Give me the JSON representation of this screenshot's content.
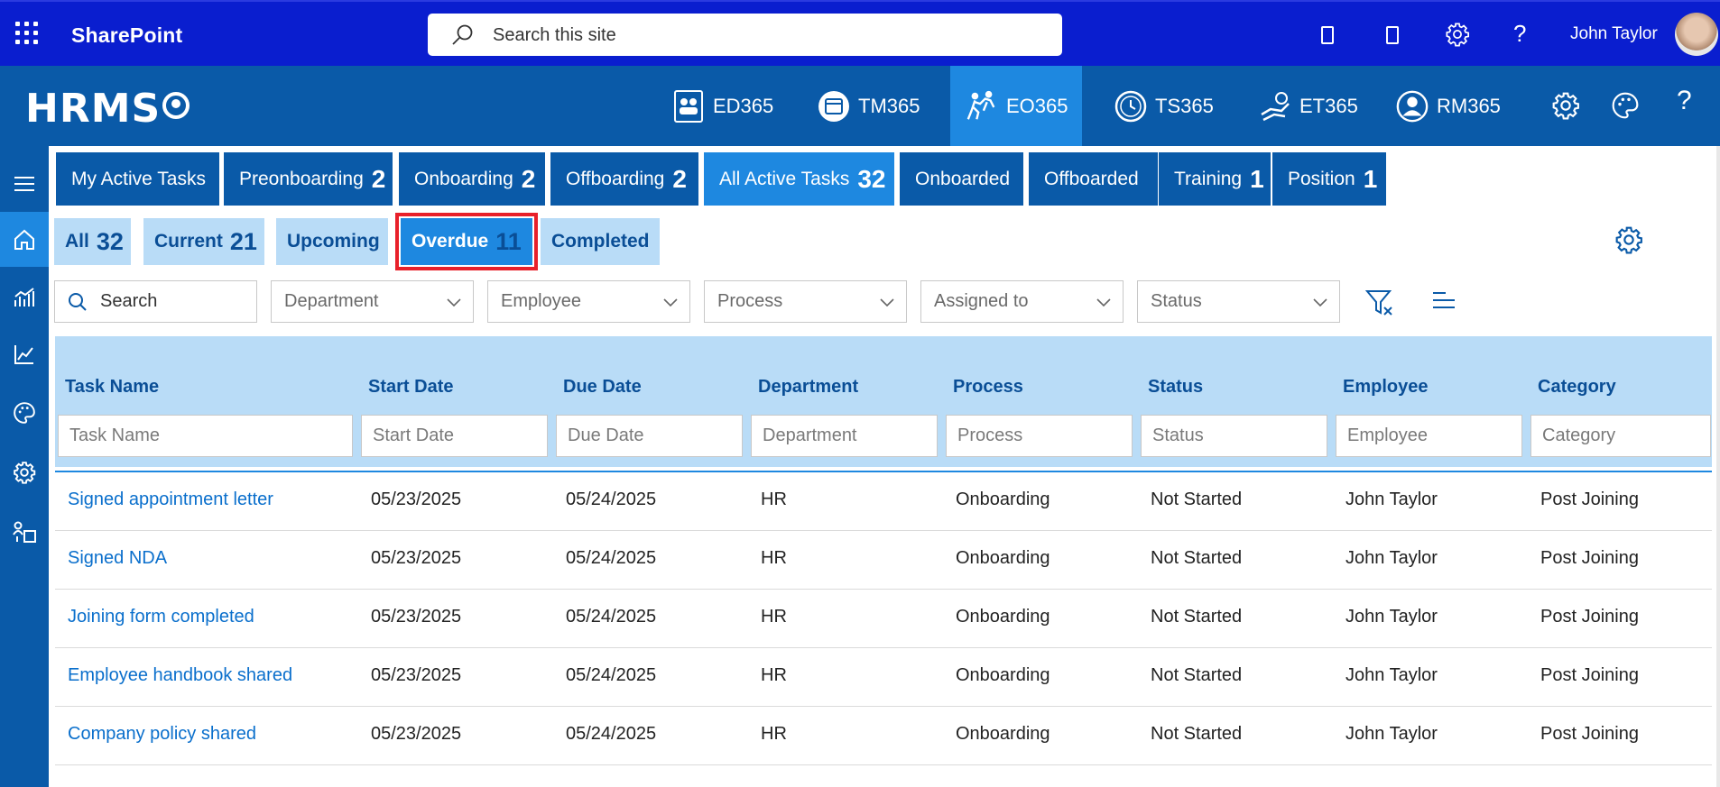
{
  "suite": {
    "app_name": "SharePoint",
    "search_placeholder": "Search this site",
    "user_name": "John Taylor"
  },
  "header": {
    "logo_text": "HRMS",
    "nav": [
      {
        "label": "ED365"
      },
      {
        "label": "TM365"
      },
      {
        "label": "EO365",
        "active": true
      },
      {
        "label": "TS365"
      },
      {
        "label": "ET365"
      },
      {
        "label": "RM365"
      }
    ]
  },
  "main_tabs": [
    {
      "label": "My Active Tasks",
      "count": ""
    },
    {
      "label": "Preonboarding",
      "count": "2"
    },
    {
      "label": "Onboarding",
      "count": "2"
    },
    {
      "label": "Offboarding",
      "count": "2"
    },
    {
      "label": "All Active Tasks",
      "count": "32",
      "active": true
    },
    {
      "label": "Onboarded",
      "count": ""
    },
    {
      "label": "Offboarded",
      "count": ""
    },
    {
      "label": "Training",
      "count": "1"
    },
    {
      "label": "Position",
      "count": "1"
    }
  ],
  "sub_tabs": [
    {
      "label": "All",
      "count": "32"
    },
    {
      "label": "Current",
      "count": "21"
    },
    {
      "label": "Upcoming",
      "count": ""
    },
    {
      "label": "Overdue",
      "count": "11",
      "active": true
    },
    {
      "label": "Completed",
      "count": ""
    }
  ],
  "filters": {
    "search": "Search",
    "department": "Department",
    "employee": "Employee",
    "process": "Process",
    "assigned_to": "Assigned to",
    "status": "Status"
  },
  "table": {
    "columns": [
      "Task Name",
      "Start Date",
      "Due Date",
      "Department",
      "Process",
      "Status",
      "Employee",
      "Category"
    ],
    "column_filters": [
      "Task Name",
      "Start Date",
      "Due Date",
      "Department",
      "Process",
      "Status",
      "Employee",
      "Category"
    ],
    "rows": [
      [
        "Signed appointment letter",
        "05/23/2025",
        "05/24/2025",
        "HR",
        "Onboarding",
        "Not Started",
        "John Taylor",
        "Post Joining"
      ],
      [
        "Signed NDA",
        "05/23/2025",
        "05/24/2025",
        "HR",
        "Onboarding",
        "Not Started",
        "John Taylor",
        "Post Joining"
      ],
      [
        "Joining form completed",
        "05/23/2025",
        "05/24/2025",
        "HR",
        "Onboarding",
        "Not Started",
        "John Taylor",
        "Post Joining"
      ],
      [
        "Employee handbook shared",
        "05/23/2025",
        "05/24/2025",
        "HR",
        "Onboarding",
        "Not Started",
        "John Taylor",
        "Post Joining"
      ],
      [
        "Company policy shared",
        "05/23/2025",
        "05/24/2025",
        "HR",
        "Onboarding",
        "Not Started",
        "John Taylor",
        "Post Joining"
      ]
    ]
  },
  "colors": {
    "suite_bar": "#0a1ecf",
    "app_header": "#0a5aa8",
    "active_tab": "#1e88e0",
    "light_tab": "#b9dcf7",
    "highlight_outline": "#e8202a",
    "link": "#0a6fcc"
  }
}
